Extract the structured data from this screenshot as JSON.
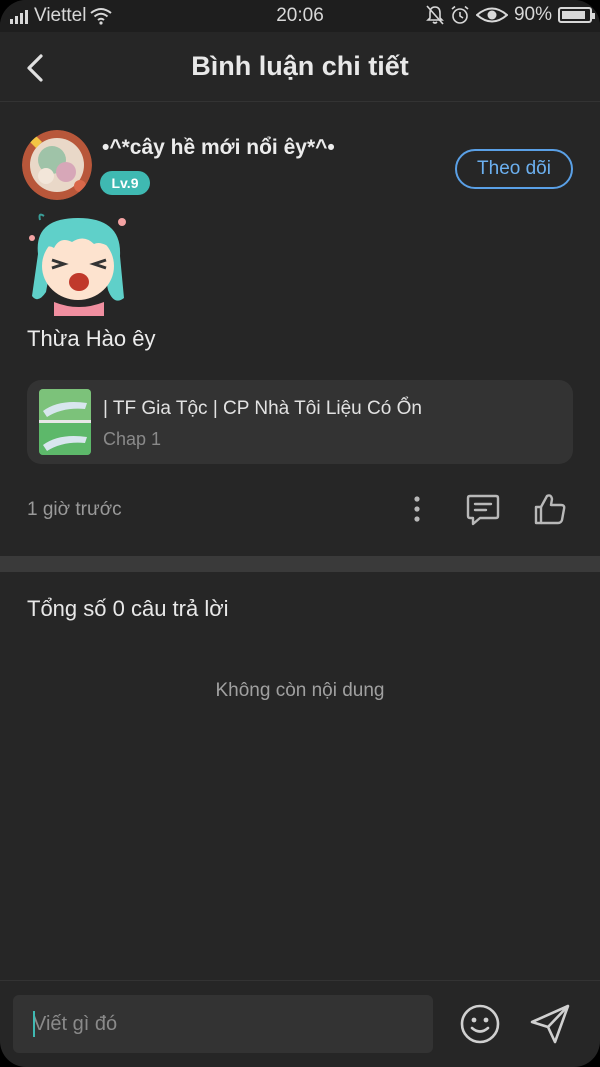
{
  "status_bar": {
    "carrier": "Viettel",
    "time": "20:06",
    "battery_pct": "90%",
    "battery_level": 0.9
  },
  "header": {
    "title": "Bình luận chi tiết"
  },
  "comment": {
    "username": "•^*cây hề mới nổi êy*^•",
    "level": "Lv.9",
    "follow_label": "Theo dõi",
    "text": "Thừa Hào êy",
    "reference": {
      "title": "| TF Gia Tộc | CP Nhà Tôi Liệu Có Ổn",
      "chapter": "Chap 1"
    },
    "time_ago": "1 giờ trước"
  },
  "replies": {
    "summary": "Tổng số 0 câu trả lời",
    "empty_note": "Không còn nội dung"
  },
  "input_bar": {
    "placeholder": "Viết gì đó"
  },
  "colors": {
    "accent": "#3fb9b2",
    "follow": "#5aa0e6",
    "background": "#262626"
  },
  "icons": [
    "back-icon",
    "more-icon",
    "reply-icon",
    "like-icon",
    "emoji-icon",
    "send-icon"
  ]
}
